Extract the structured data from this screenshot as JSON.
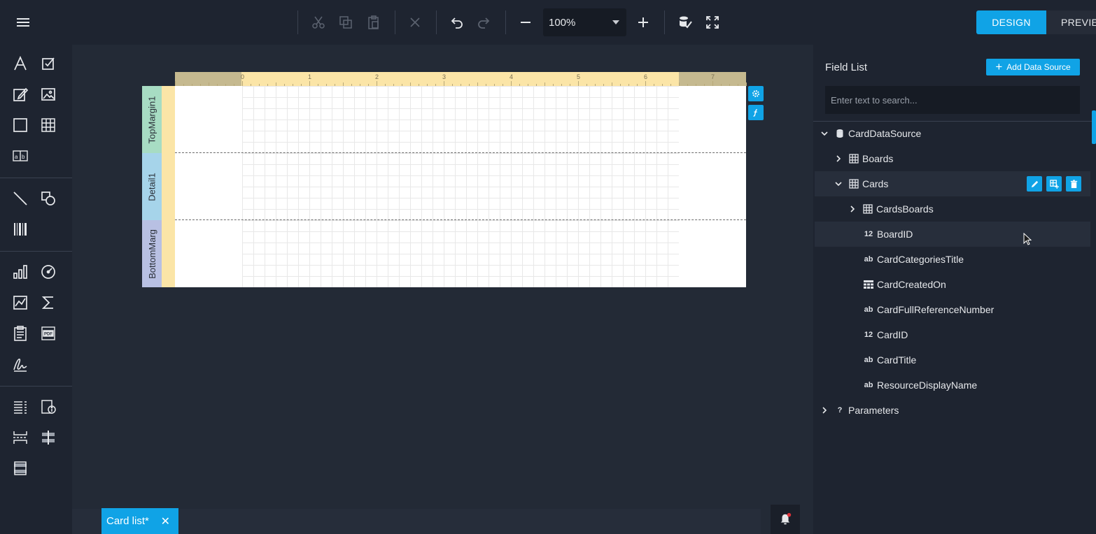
{
  "toolbar": {
    "zoom_value": "100%",
    "mode_design": "DESIGN",
    "mode_preview": "PREVIEW"
  },
  "report": {
    "ruler_numbers": [
      "0",
      "1",
      "2",
      "3",
      "4",
      "5",
      "6",
      "7"
    ],
    "bands": [
      "TopMargin1",
      "Detail1",
      "BottomMarg"
    ]
  },
  "field_list": {
    "title": "Field List",
    "add_button": "Add Data Source",
    "search_placeholder": "Enter text to search...",
    "items": [
      {
        "label": "CardDataSource",
        "icon": "database-icon",
        "type_glyph": ""
      },
      {
        "label": "Boards",
        "icon": "table-icon",
        "type_glyph": ""
      },
      {
        "label": "Cards",
        "icon": "table-icon",
        "type_glyph": ""
      },
      {
        "label": "CardsBoards",
        "icon": "table-icon",
        "type_glyph": ""
      },
      {
        "label": "BoardID",
        "icon": "number-type-icon",
        "type_glyph": "12"
      },
      {
        "label": "CardCategoriesTitle",
        "icon": "string-type-icon",
        "type_glyph": "ab"
      },
      {
        "label": "CardCreatedOn",
        "icon": "date-type-icon",
        "type_glyph": ""
      },
      {
        "label": "CardFullReferenceNumber",
        "icon": "string-type-icon",
        "type_glyph": "ab"
      },
      {
        "label": "CardID",
        "icon": "number-type-icon",
        "type_glyph": "12"
      },
      {
        "label": "CardTitle",
        "icon": "string-type-icon",
        "type_glyph": "ab"
      },
      {
        "label": "ResourceDisplayName",
        "icon": "string-type-icon",
        "type_glyph": "ab"
      },
      {
        "label": "Parameters",
        "icon": "parameters-icon",
        "type_glyph": "?"
      }
    ]
  },
  "document_tab": {
    "label": "Card list*"
  },
  "colors": {
    "accent": "#10a3e6",
    "background": "#1e2430",
    "canvas": "#232a36"
  }
}
